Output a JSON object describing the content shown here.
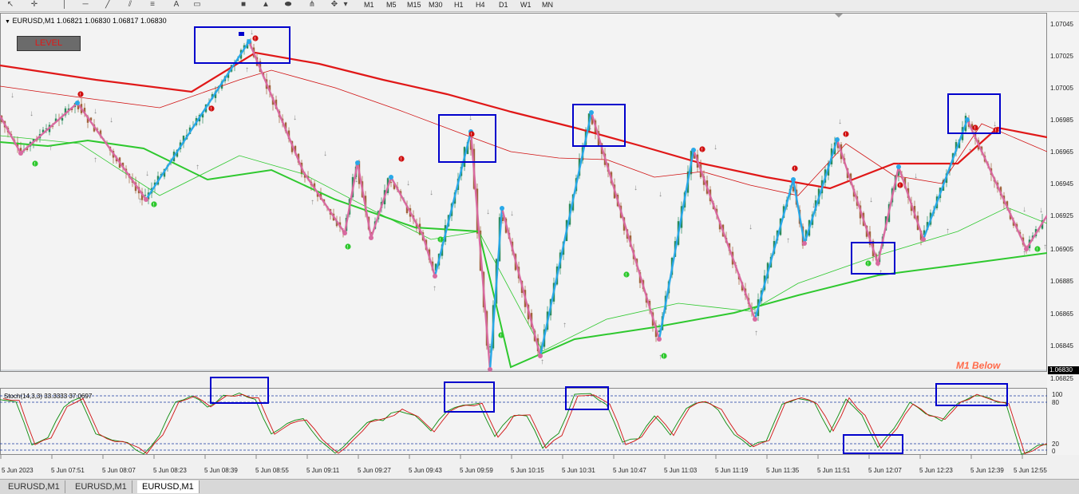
{
  "chart": {
    "title": "EURUSD,M1  1.06821 1.06830 1.06817 1.06830",
    "level_button": "LEVEL",
    "annotation": "M1 Below",
    "current_price": "1.06830"
  },
  "timeframes": [
    "M1",
    "M5",
    "M15",
    "M30",
    "H1",
    "H4",
    "D1",
    "W1",
    "MN"
  ],
  "price_labels": [
    "1.07045",
    "1.07025",
    "1.07005",
    "1.06985",
    "1.06965",
    "1.06945",
    "1.06925",
    "1.06905",
    "1.06885",
    "1.06865",
    "1.06845",
    "1.06825"
  ],
  "oscillator": {
    "title": "Stoch(14,3,3) 33.3333 37.0697",
    "levels": [
      "100",
      "80",
      "20",
      "0"
    ]
  },
  "time_labels": [
    "5 Jun 2023",
    "5 Jun 07:51",
    "5 Jun 08:07",
    "5 Jun 08:23",
    "5 Jun 08:39",
    "5 Jun 08:55",
    "5 Jun 09:11",
    "5 Jun 09:27",
    "5 Jun 09:43",
    "5 Jun 09:59",
    "5 Jun 10:15",
    "5 Jun 10:31",
    "5 Jun 10:47",
    "5 Jun 11:03",
    "5 Jun 11:19",
    "5 Jun 11:35",
    "5 Jun 11:51",
    "5 Jun 12:07",
    "5 Jun 12:23",
    "5 Jun 12:39",
    "5 Jun 12:55"
  ],
  "tabs": [
    {
      "label": "EURUSD,M1",
      "active": false
    },
    {
      "label": "EURUSD,M1",
      "active": false
    },
    {
      "label": "EURUSD,M1",
      "active": true
    }
  ],
  "colors": {
    "ma_slow": "#e01818",
    "ma_fast_red": "#d01010",
    "ma_green": "#2ec82e",
    "zigzag_up": "#29a8e8",
    "zigzag_down": "#d86aa0",
    "candle_up": "#2a8a5a",
    "candle_down": "#a0623a",
    "highlight_box": "#0000cc",
    "stoch_main": "#0a8a0a",
    "stoch_signal": "#d01010"
  }
}
